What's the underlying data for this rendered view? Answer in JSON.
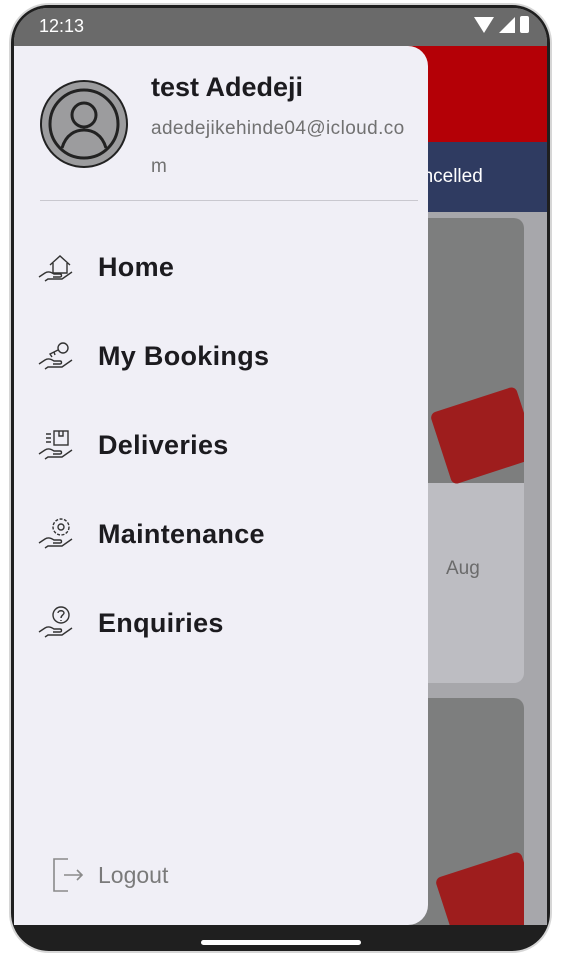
{
  "status": {
    "time": "12:13"
  },
  "background": {
    "tab_partial": "ancelled",
    "card_date_partial": "Aug"
  },
  "drawer": {
    "user_name": "test Adedeji",
    "user_email": "adedejikehinde04@icloud.com",
    "nav_items": [
      {
        "label": "Home",
        "icon": "home-hand-icon"
      },
      {
        "label": "My Bookings",
        "icon": "bookings-key-icon"
      },
      {
        "label": "Deliveries",
        "icon": "delivery-box-icon"
      },
      {
        "label": "Maintenance",
        "icon": "maintenance-gear-icon"
      },
      {
        "label": "Enquiries",
        "icon": "enquiry-question-icon"
      }
    ],
    "logout_label": "Logout"
  },
  "colors": {
    "header_red": "#b40006",
    "tab_navy": "#2f3b61",
    "drawer_bg": "#f0eff6"
  }
}
